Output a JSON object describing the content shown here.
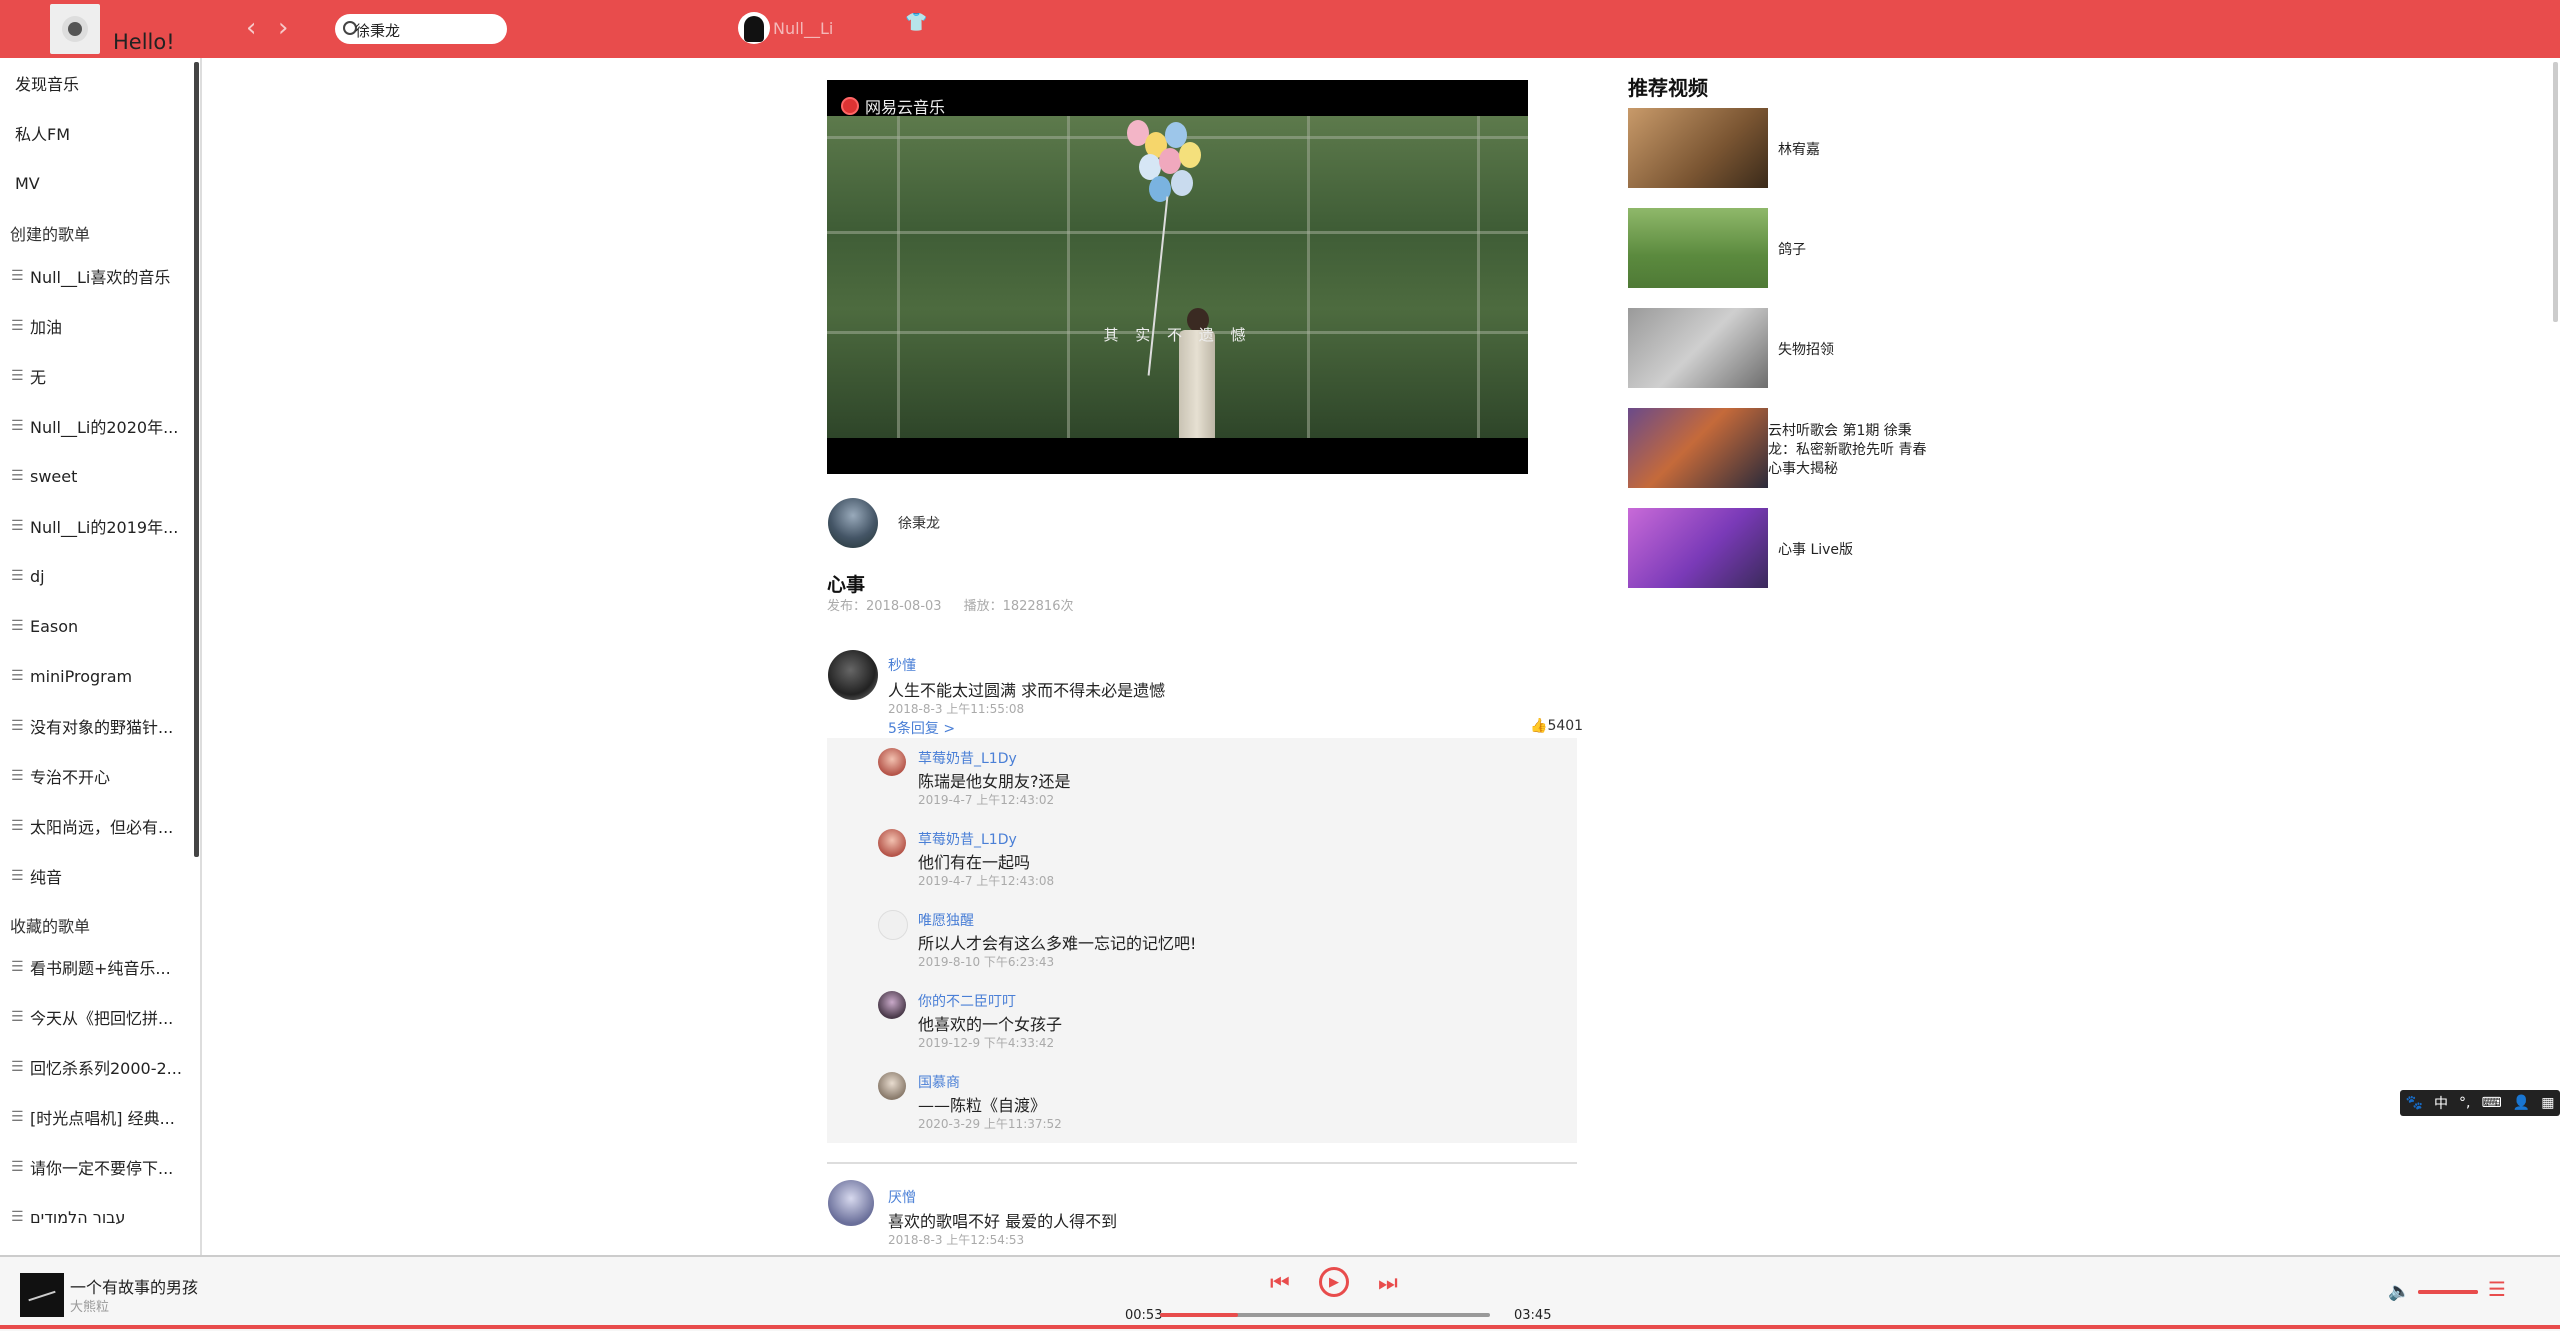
{
  "header": {
    "greeting": "Hello!",
    "search_value": "徐秉龙",
    "username": "Null__Li"
  },
  "sidebar": {
    "top_items": [
      {
        "label": "发现音乐"
      },
      {
        "label": "私人FM"
      },
      {
        "label": "MV"
      }
    ],
    "created_title": "创建的歌单",
    "created": [
      {
        "label": "Null__Li喜欢的音乐"
      },
      {
        "label": "加油"
      },
      {
        "label": "无"
      },
      {
        "label": "Null__Li的2020年..."
      },
      {
        "label": "sweet"
      },
      {
        "label": "Null__Li的2019年..."
      },
      {
        "label": "dj"
      },
      {
        "label": "Eason"
      },
      {
        "label": "miniProgram"
      },
      {
        "label": "没有对象的野猫针..."
      },
      {
        "label": "专治不开心"
      },
      {
        "label": "太阳尚远，但必有..."
      },
      {
        "label": "纯音"
      }
    ],
    "collected_title": "收藏的歌单",
    "collected": [
      {
        "label": "看书刷题+纯音乐..."
      },
      {
        "label": "今天从《把回忆拼..."
      },
      {
        "label": "回忆杀系列2000-2..."
      },
      {
        "label": "[时光点唱机] 经典..."
      },
      {
        "label": "请你一定不要停下..."
      },
      {
        "label": "עבור הלמודים"
      }
    ]
  },
  "video": {
    "watermark": "网易云音乐",
    "subtitle": "其 实 不 遗 憾"
  },
  "mv": {
    "author": "徐秉龙",
    "title": "心事",
    "published": "发布：2018-08-03",
    "plays": "播放：1822816次"
  },
  "comments": [
    {
      "name": "秒懂",
      "text": "人生不能太过圆满 求而不得未必是遗憾",
      "time": "2018-8-3 上午11:55:08",
      "replies_label": "5条回复 >",
      "likes": "5401",
      "replies": [
        {
          "name": "草莓奶昔_L1Dy",
          "text": "陈瑞是他女朋友?还是",
          "time": "2019-4-7 上午12:43:02"
        },
        {
          "name": "草莓奶昔_L1Dy",
          "text": "他们有在一起吗",
          "time": "2019-4-7 上午12:43:08"
        },
        {
          "name": "唯愿独醒",
          "text": "所以人才会有这么多难一忘记的记忆吧!",
          "time": "2019-8-10 下午6:23:43"
        },
        {
          "name": "你的不二臣叮叮",
          "text": "他喜欢的一个女孩子",
          "time": "2019-12-9 下午4:33:42"
        },
        {
          "name": "国慕商",
          "text": "——陈粒《自渡》",
          "time": "2020-3-29 上午11:37:52"
        }
      ]
    },
    {
      "name": "厌憎",
      "text": "喜欢的歌唱不好 最爱的人得不到",
      "time": "2018-8-3 上午12:54:53"
    }
  ],
  "recommend": {
    "title": "推荐视频",
    "items": [
      {
        "label": "林宥嘉"
      },
      {
        "label": "鸽子"
      },
      {
        "label": "失物招领"
      },
      {
        "label": "云村听歌会 第1期 徐秉龙：私密新歌抢先听 青春心事大揭秘"
      },
      {
        "label": "心事 Live版"
      }
    ]
  },
  "ime": {
    "label": "中"
  },
  "player": {
    "title": "一个有故事的男孩",
    "artist": "大熊粒",
    "current_time": "00:53",
    "duration": "03:45",
    "progress": 0.235,
    "volume": 1.0
  }
}
